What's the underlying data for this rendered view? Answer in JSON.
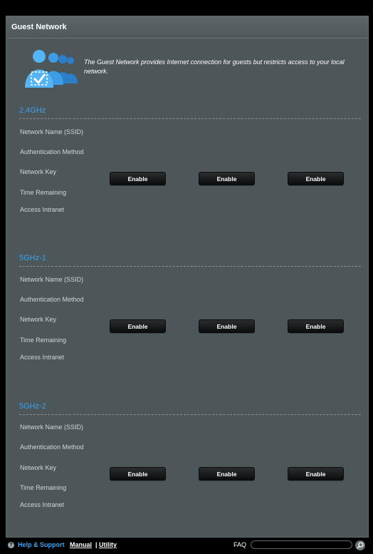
{
  "header": {
    "title": "Guest Network"
  },
  "intro": {
    "text": "The Guest Network provides Internet connection for guests but restricts access to your local network."
  },
  "bands": [
    {
      "name": "2.4GHz",
      "labels": [
        "Network Name (SSID)",
        "Authentication Method",
        "Network Key",
        "Time Remaining",
        "Access Intranet"
      ],
      "buttons": [
        "Enable",
        "Enable",
        "Enable"
      ]
    },
    {
      "name": "5GHz-1",
      "labels": [
        "Network Name (SSID)",
        "Authentication Method",
        "Network Key",
        "Time Remaining",
        "Access Intranet"
      ],
      "buttons": [
        "Enable",
        "Enable",
        "Enable"
      ]
    },
    {
      "name": "5GHz-2",
      "labels": [
        "Network Name (SSID)",
        "Authentication Method",
        "Network Key",
        "Time Remaining",
        "Access Intranet"
      ],
      "buttons": [
        "Enable",
        "Enable",
        "Enable"
      ]
    }
  ],
  "footer": {
    "help_label": "Help & Support",
    "manual_label": "Manual",
    "separator": "|",
    "utility_label": "Utility",
    "faq_label": "FAQ",
    "faq_placeholder": ""
  },
  "icons": {
    "intro": "guest-users-icon",
    "help": "help-icon",
    "search": "search-icon"
  },
  "colors": {
    "accent": "#3ba3ef",
    "panel": "#4d5659",
    "button": "#1a1c1e"
  }
}
